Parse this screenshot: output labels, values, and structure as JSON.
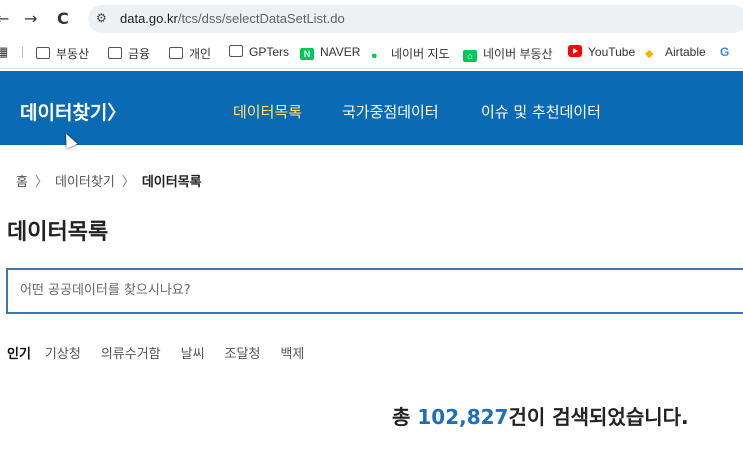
{
  "browser": {
    "back": "←",
    "forward": "→",
    "reload": "C",
    "url_host": "data.go.kr",
    "url_path": "/tcs/dss/selectDataSetList.do"
  },
  "bookmarks": [
    {
      "label": "부동산",
      "icon": "folder-icon"
    },
    {
      "label": "금융",
      "icon": "folder-icon"
    },
    {
      "label": "개인",
      "icon": "folder-icon"
    },
    {
      "label": "GPTers",
      "icon": "folder-icon"
    },
    {
      "label": "NAVER",
      "icon": "naver-icon"
    },
    {
      "label": "네이버 지도",
      "icon": "naver-map-icon"
    },
    {
      "label": "네이버 부동산",
      "icon": "naver-land-icon"
    },
    {
      "label": "YouTube",
      "icon": "youtube-icon"
    },
    {
      "label": "Airtable",
      "icon": "airtable-icon"
    },
    {
      "label": "G",
      "icon": "google-icon"
    }
  ],
  "header": {
    "brand": "데이터찾기",
    "nav": [
      {
        "label": "데이터목록",
        "active": true
      },
      {
        "label": "국가중점데이터",
        "active": false
      },
      {
        "label": "이슈 및 추천데이터",
        "active": false
      }
    ]
  },
  "breadcrumb": {
    "home": "홈",
    "sep": "〉",
    "parent": "데이터찾기",
    "current": "데이터목록"
  },
  "page_title": "데이터목록",
  "search": {
    "placeholder": "어떤 공공데이터를 찾으시나요?",
    "value": ""
  },
  "popular": {
    "label": "인기",
    "tags": [
      "기상청",
      "의류수거함",
      "날씨",
      "조달청",
      "백제"
    ]
  },
  "result": {
    "prefix": "총 ",
    "count": "102,827",
    "suffix": "건이 검색되었습니다."
  },
  "colors": {
    "header_bg": "#0b6ab4",
    "active_nav": "#ffe77a",
    "count_blue": "#1f6fb8",
    "search_border": "#3c77b0"
  }
}
